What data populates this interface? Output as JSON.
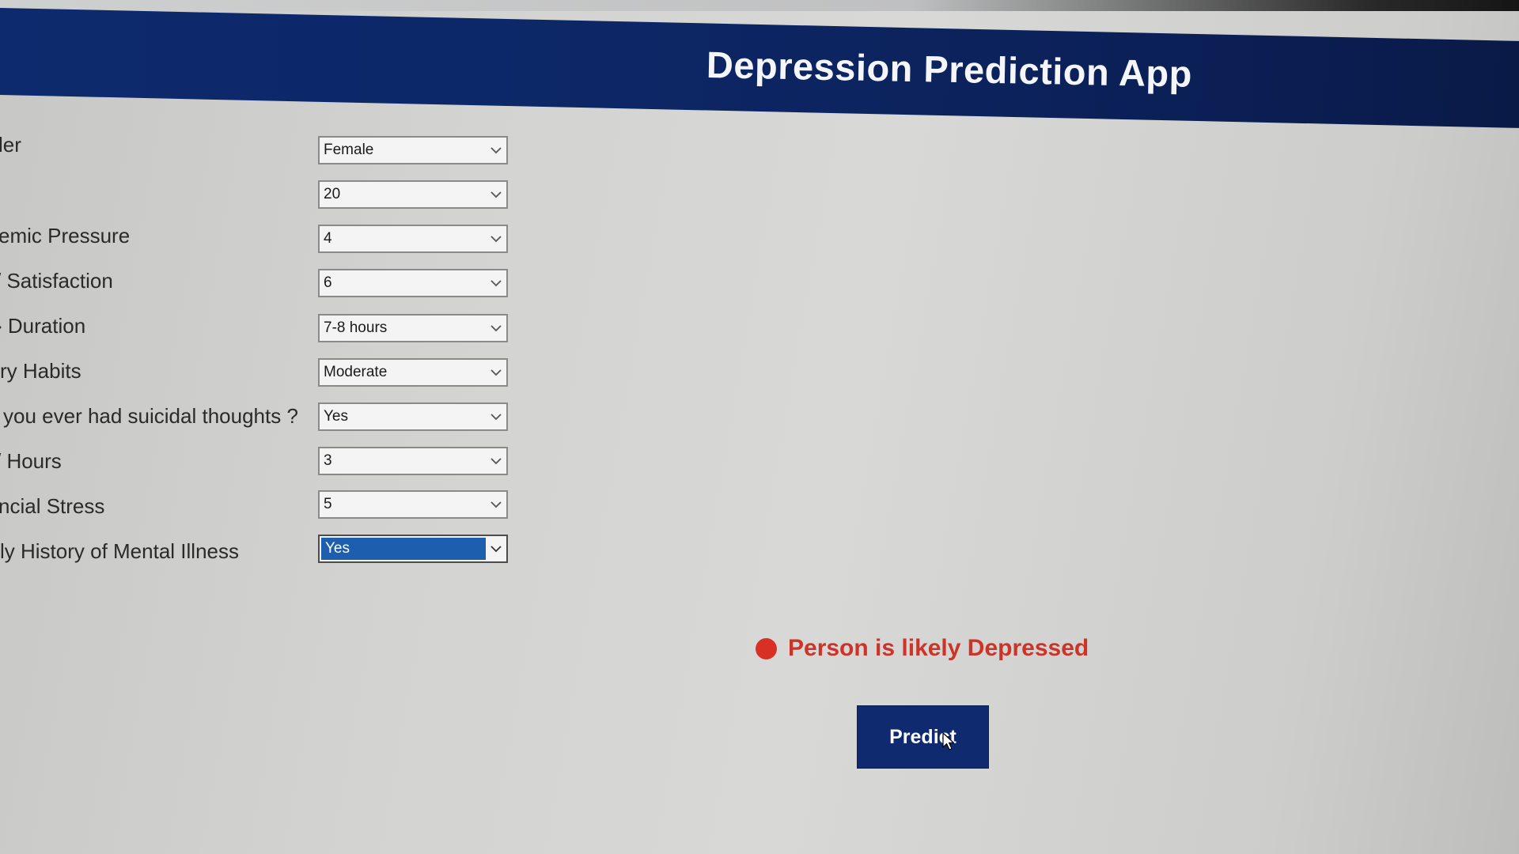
{
  "app": {
    "title": "Depression Prediction App"
  },
  "form": {
    "fields": [
      {
        "label": "ler",
        "value": "Female"
      },
      {
        "label": "",
        "value": "20"
      },
      {
        "label": "emic Pressure",
        "value": "4"
      },
      {
        "label": "/ Satisfaction",
        "value": "6"
      },
      {
        "label": "› Duration",
        "value": "7-8 hours"
      },
      {
        "label": "ry Habits",
        "value": "Moderate"
      },
      {
        "label": "you ever had suicidal thoughts ?",
        "value": "Yes"
      },
      {
        "label": "/ Hours",
        "value": "3"
      },
      {
        "label": "ncial Stress",
        "value": "5"
      },
      {
        "label": "ly History of Mental Illness",
        "value": "Yes"
      }
    ]
  },
  "result": {
    "text": "Person is likely Depressed",
    "status_color": "#d93025"
  },
  "predict": {
    "label": "Predict"
  },
  "colors": {
    "header": "#0d2a6e",
    "button": "#0f2a6e",
    "selected_option": "#1d5fae"
  },
  "icons": {
    "dropdown": "chevron-down-icon",
    "status": "red-dot-icon",
    "cursor": "mouse-pointer-icon"
  }
}
